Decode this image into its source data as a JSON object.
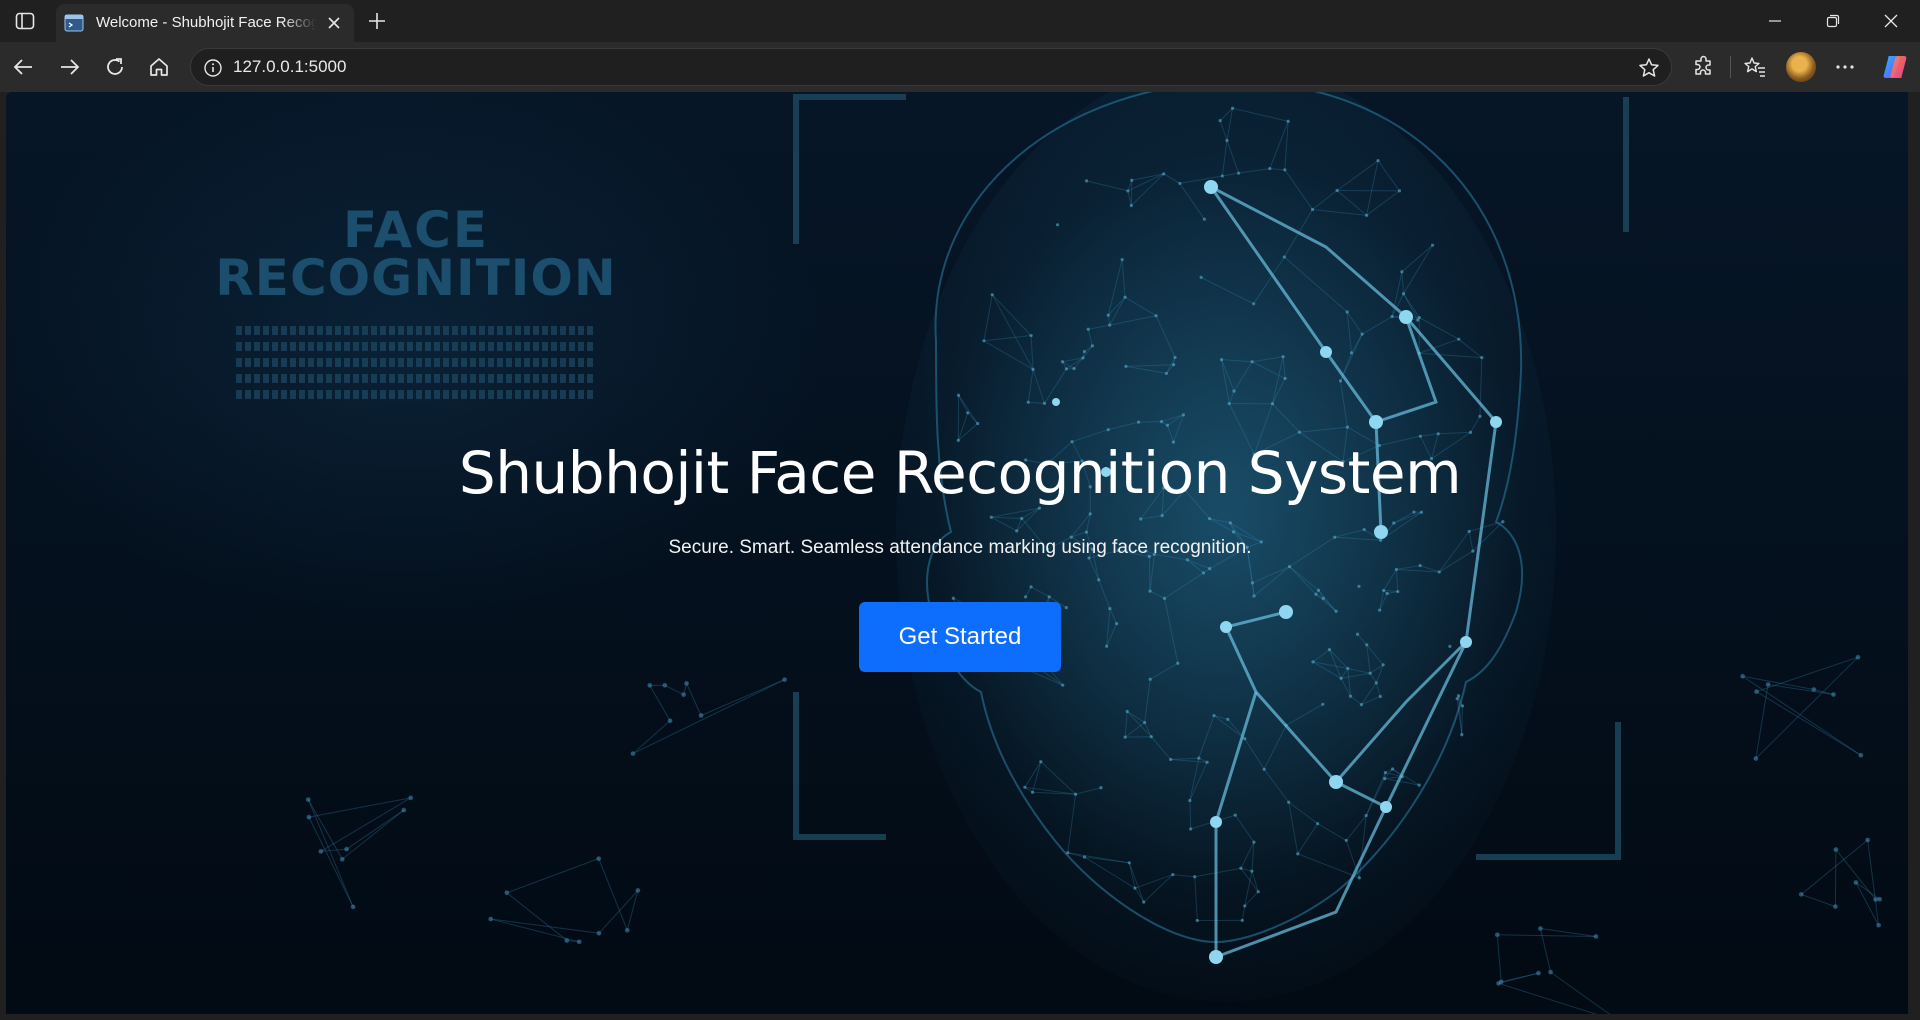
{
  "browser": {
    "tab": {
      "title": "Welcome - Shubhojit Face Recognition System"
    },
    "address_bar": {
      "url": "127.0.0.1:5000"
    },
    "icons": [
      "sidebar-toggle-icon",
      "terminal-favicon-icon",
      "close-icon",
      "new-tab-icon",
      "minimize-icon",
      "restore-icon",
      "window-close-icon",
      "back-icon",
      "forward-icon",
      "reload-icon",
      "home-icon",
      "info-icon",
      "star-icon",
      "extensions-icon",
      "favorites-icon",
      "avatar",
      "more-icon",
      "copilot-icon"
    ]
  },
  "page": {
    "logo": {
      "line1": "FACE",
      "line2": "RECOGNITION"
    },
    "hero": {
      "title": "Shubhojit Face Recognition System",
      "subtitle": "Secure. Smart. Seamless attendance marking using face recognition.",
      "cta_label": "Get Started"
    }
  },
  "colors": {
    "accent": "#0d6efd",
    "background": "#04101d",
    "mesh": "#2a7fa6"
  }
}
